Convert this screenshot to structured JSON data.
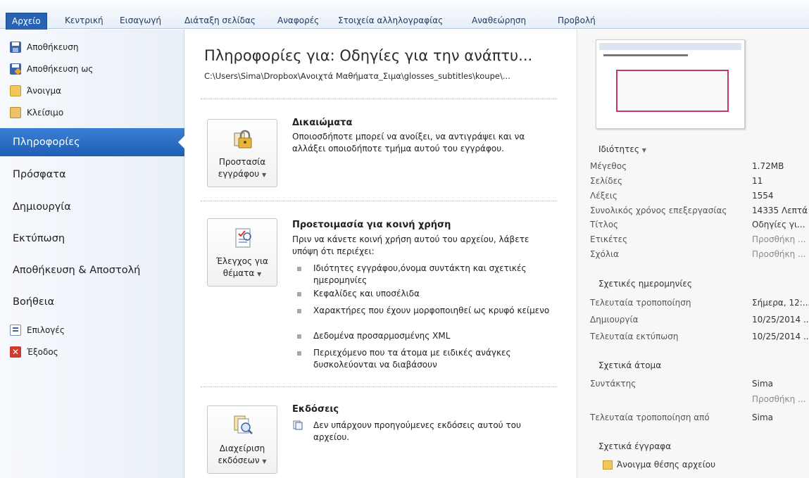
{
  "ribbon": {
    "tabs": [
      "Αρχείο",
      "Κεντρική",
      "Εισαγωγή",
      "Διάταξη σελίδας",
      "Αναφορές",
      "Στοιχεία αλληλογραφίας",
      "Αναθεώρηση",
      "Προβολή"
    ]
  },
  "nav": {
    "commands_top": [
      "Αποθήκευση",
      "Αποθήκευση ως",
      "Άνοιγμα",
      "Κλείσιμο"
    ],
    "tabs": [
      "Πληροφορίες",
      "Πρόσφατα",
      "Δημιουργία",
      "Εκτύπωση",
      "Αποθήκευση & Αποστολή",
      "Βοήθεια"
    ],
    "active_tab": "Πληροφορίες",
    "commands_bottom": [
      "Επιλογές",
      "Έξοδος"
    ]
  },
  "main": {
    "title": "Πληροφορίες για: Οδηγίες για την ανάπτυ...",
    "path": "C:\\Users\\Sima\\Dropbox\\Ανοιχτά Μαθήματα_Σιμα\\glosses_subtitles\\koupe\\...",
    "permissions": {
      "button_line1": "Προστασία",
      "button_line2": "εγγράφου",
      "title": "Δικαιώματα",
      "text": "Οποιοσδήποτε μπορεί να ανοίξει, να αντιγράψει και να αλλάξει οποιοδήποτε τμήμα αυτού του εγγράφου."
    },
    "prepare": {
      "button_line1": "Έλεγχος για",
      "button_line2": "θέματα",
      "title": "Προετοιμασία για κοινή χρήση",
      "text": "Πριν να κάνετε κοινή χρήση αυτού του αρχείου, λάβετε υπόψη ότι περιέχει:",
      "bullets": [
        "Ιδιότητες εγγράφου,όνομα συντάκτη και σχετικές ημερομηνίες",
        "Κεφαλίδες και υποσέλιδα",
        "Χαρακτήρες που έχουν μορφοποιηθεί ως κρυφό κείμενο",
        "Δεδομένα προσαρμοσμένης XML",
        "Περιεχόμενο που τα άτομα με ειδικές ανάγκες δυσκολεύονται να διαβάσουν"
      ]
    },
    "versions": {
      "button_line1": "Διαχείριση",
      "button_line2": "εκδόσεων",
      "title": "Εκδόσεις",
      "text": "Δεν υπάρχουν προηγούμενες εκδόσεις αυτού του αρχείου."
    }
  },
  "props": {
    "header": "Ιδιότητες",
    "rows": [
      {
        "label": "Μέγεθος",
        "value": "1.72MB"
      },
      {
        "label": "Σελίδες",
        "value": "11"
      },
      {
        "label": "Λέξεις",
        "value": "1554"
      },
      {
        "label": "Συνολικός χρόνος επεξεργασίας",
        "value": "14335 Λεπτά"
      },
      {
        "label": "Τίτλος",
        "value": "Οδηγίες γι..."
      },
      {
        "label": "Ετικέτες",
        "value": "Προσθήκη ..."
      },
      {
        "label": "Σχόλια",
        "value": "Προσθήκη ..."
      }
    ],
    "dates_header": "Σχετικές ημερομηνίες",
    "dates": [
      {
        "label": "Τελευταία τροποποίηση",
        "value": "Σήμερα, 12:..."
      },
      {
        "label": "Δημιουργία",
        "value": "10/25/2014 ..."
      },
      {
        "label": "Τελευταία εκτύπωση",
        "value": "10/25/2014 ..."
      }
    ],
    "people_header": "Σχετικά άτομα",
    "author_label": "Συντάκτης",
    "author_value": "Sima",
    "author_add": "Προσθήκη ...",
    "modified_by_label": "Τελευταία τροποποίηση από",
    "modified_by_value": "Sima",
    "docs_header": "Σχετικά έγγραφα",
    "open_location": "Άνοιγμα θέσης αρχείου"
  }
}
